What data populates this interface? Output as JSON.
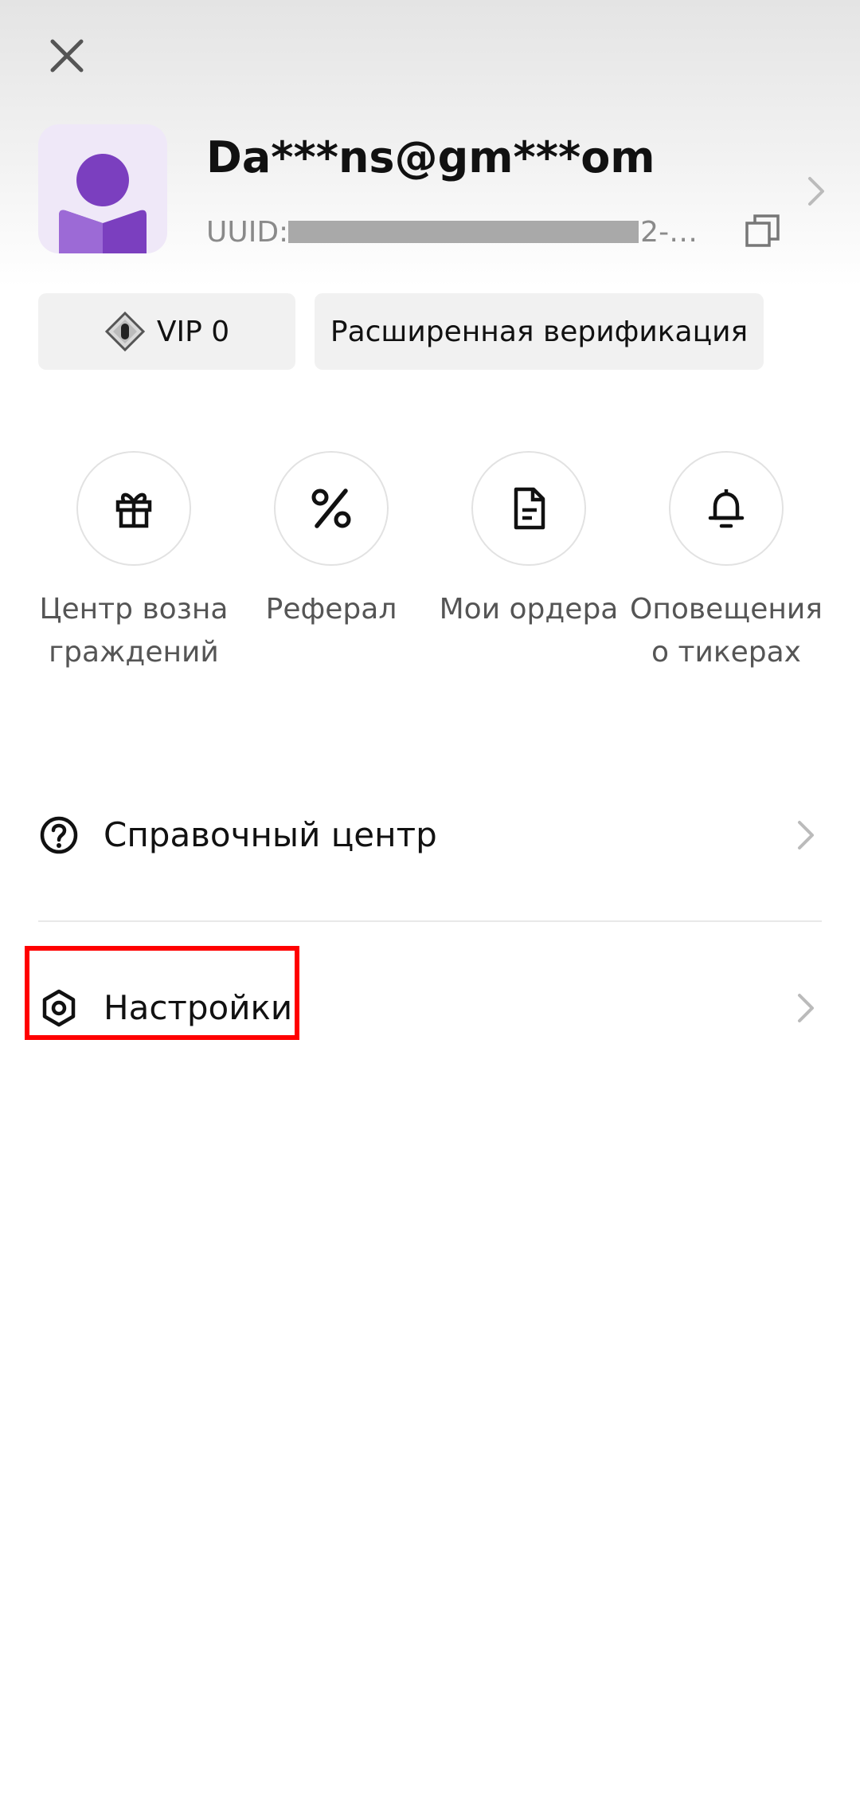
{
  "header": {
    "close_icon": "close-icon"
  },
  "profile": {
    "email": "Da***ns@gm***om",
    "uid_label": "UUID:",
    "uid_tail": "2-…",
    "avatar_color": "#7b3fbf",
    "copy_icon": "copy-icon",
    "chevron_icon": "chevron-right-icon"
  },
  "chips": {
    "vip_label": "VIP 0",
    "verify_label": "Расширенная верификация"
  },
  "quick_actions": [
    {
      "label": "Центр возна граждений",
      "icon": "gift-icon"
    },
    {
      "label": "Реферал",
      "icon": "percent-icon"
    },
    {
      "label": "Мои ордера",
      "icon": "document-icon"
    },
    {
      "label": "Оповещения о тикерах",
      "icon": "bell-icon"
    }
  ],
  "menu": [
    {
      "label": "Справочный центр",
      "icon": "help-icon"
    },
    {
      "label": "Настройки",
      "icon": "settings-icon"
    }
  ],
  "colors": {
    "accent_purple": "#7b3fbf",
    "highlight": "#ff0000"
  }
}
